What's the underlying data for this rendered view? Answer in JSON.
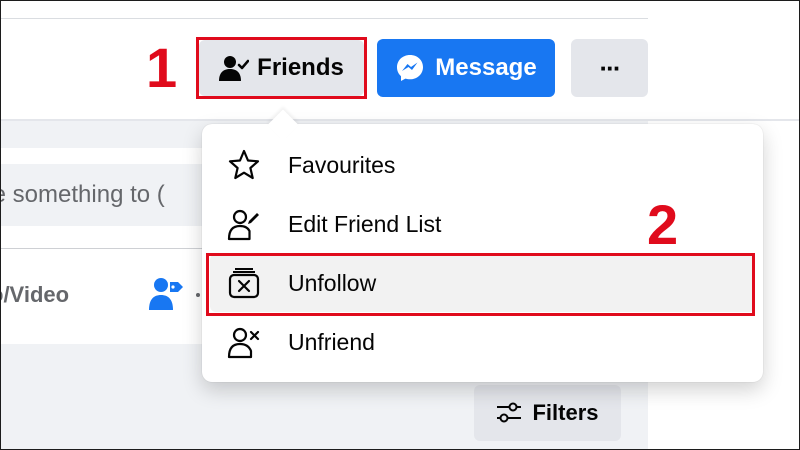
{
  "profile_actions": {
    "friends_label": "Friends",
    "message_label": "Message",
    "more_label": "···"
  },
  "composer": {
    "placeholder_fragment": "te something to (",
    "photo_video_fragment": "o/Video"
  },
  "friends_menu": {
    "items": [
      {
        "label": "Favourites",
        "icon": "star-icon"
      },
      {
        "label": "Edit Friend List",
        "icon": "edit-friend-list-icon"
      },
      {
        "label": "Unfollow",
        "icon": "unfollow-icon"
      },
      {
        "label": "Unfriend",
        "icon": "unfriend-icon"
      }
    ]
  },
  "filters": {
    "label": "Filters",
    "icon": "sliders-icon"
  },
  "annotations": {
    "step1": "1",
    "step2": "2"
  },
  "colors": {
    "accent_blue": "#1877f2",
    "annotation_red": "#e00b1c",
    "button_gray": "#e4e6eb",
    "feed_background": "#f0f2f5"
  }
}
